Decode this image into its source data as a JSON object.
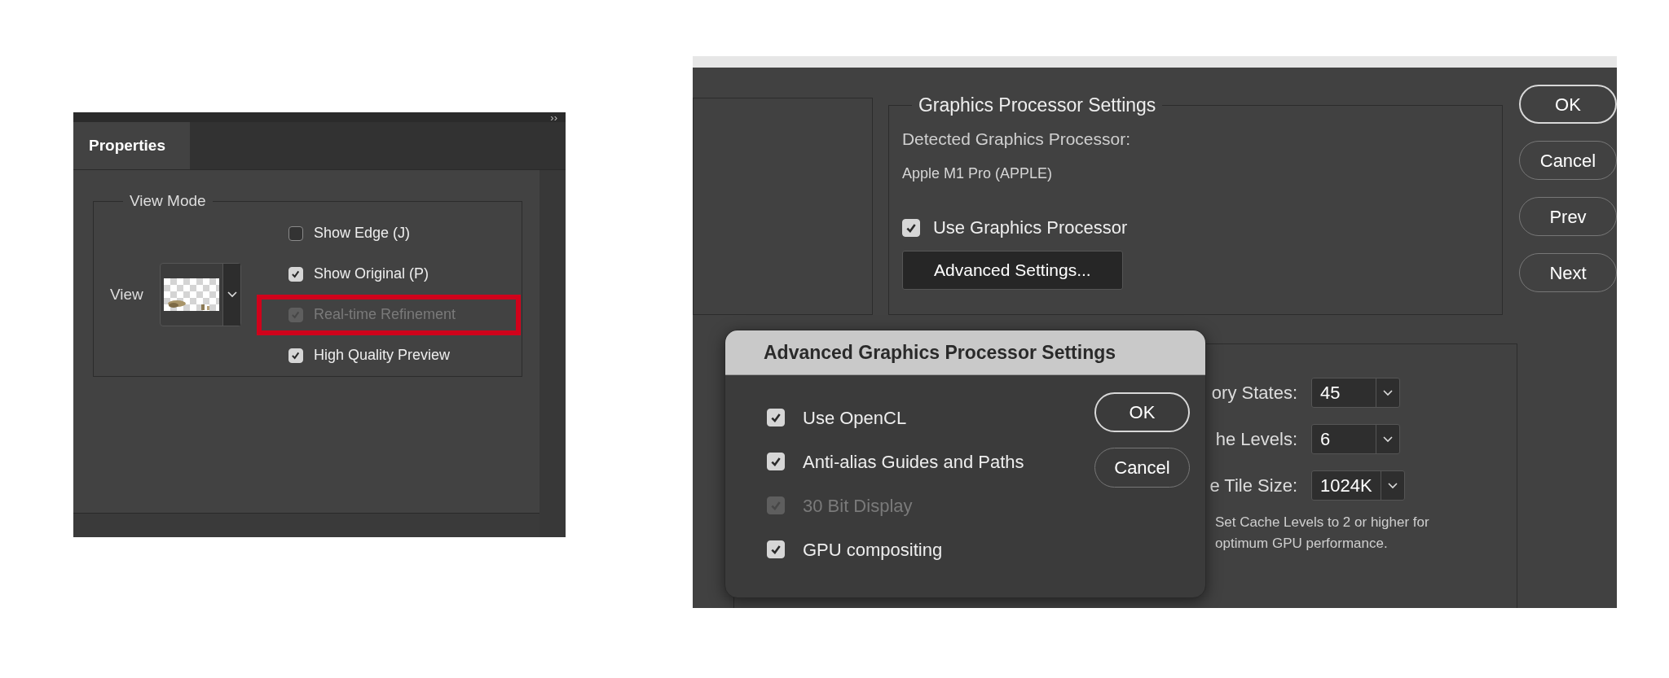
{
  "properties_panel": {
    "collapse_glyph": "››",
    "tab": {
      "label": "Properties",
      "selected": true
    },
    "view_mode": {
      "title": "View Mode",
      "view_label": "View",
      "options": [
        {
          "label": "Show Edge (J)",
          "checked": false,
          "disabled": false,
          "highlighted": false
        },
        {
          "label": "Show Original (P)",
          "checked": true,
          "disabled": false,
          "highlighted": false
        },
        {
          "label": "Real-time Refinement",
          "checked": true,
          "disabled": true,
          "highlighted": true
        },
        {
          "label": "High Quality Preview",
          "checked": true,
          "disabled": false,
          "highlighted": false
        }
      ]
    }
  },
  "preferences": {
    "graphics_processor": {
      "title": "Graphics Processor Settings",
      "detected_label": "Detected Graphics Processor:",
      "detected_value": "Apple M1 Pro (APPLE)",
      "use_gpu": {
        "label": "Use Graphics Processor",
        "checked": true,
        "disabled": false
      },
      "advanced_button": "Advanced Settings..."
    },
    "buttons": [
      "OK",
      "Cancel",
      "Prev",
      "Next"
    ],
    "performance": {
      "fields": [
        {
          "label": "ory States:",
          "value": "45"
        },
        {
          "label": "he Levels:",
          "value": "6"
        },
        {
          "label": "e Tile Size:",
          "value": "1024K"
        }
      ],
      "note": "Set Cache Levels to 2 or higher for optimum GPU performance."
    }
  },
  "advanced_dialog": {
    "title": "Advanced Graphics Processor Settings",
    "options": [
      {
        "label": "Use OpenCL",
        "checked": true,
        "disabled": false
      },
      {
        "label": "Anti-alias Guides and Paths",
        "checked": true,
        "disabled": false
      },
      {
        "label": "30 Bit Display",
        "checked": true,
        "disabled": true
      },
      {
        "label": "GPU compositing",
        "checked": true,
        "disabled": false
      }
    ],
    "buttons": [
      "OK",
      "Cancel"
    ]
  }
}
